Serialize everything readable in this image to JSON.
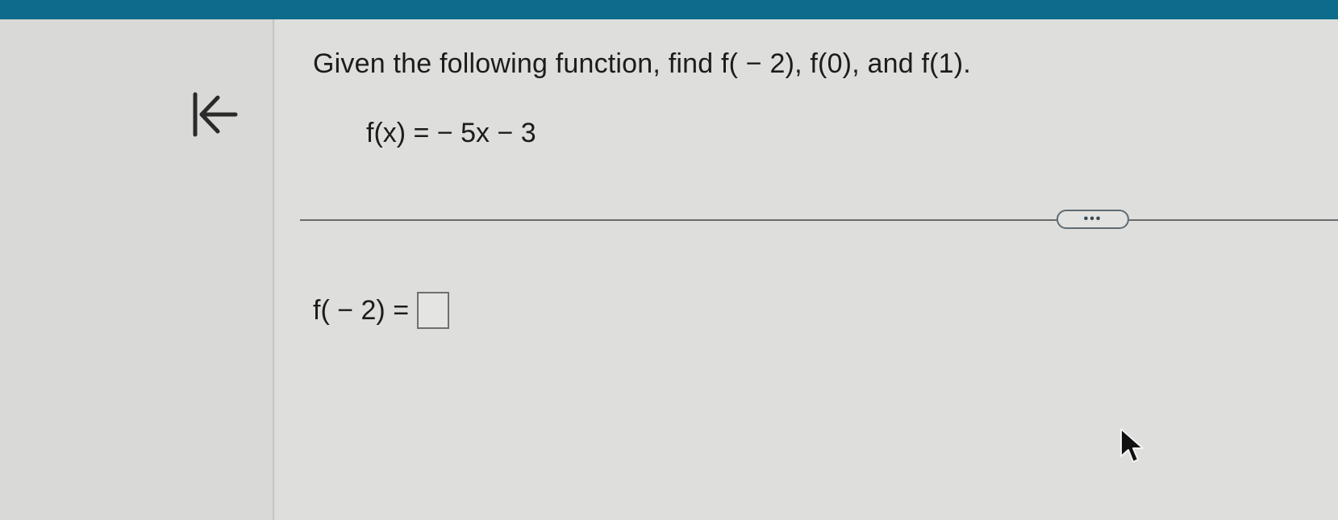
{
  "header": {
    "accent_color": "#0d6b8c"
  },
  "nav": {
    "back_icon": "skip-to-first-icon"
  },
  "question": {
    "prompt": "Given the following function, find f( − 2), f(0), and f(1).",
    "function": "f(x) = − 5x − 3"
  },
  "toolbar": {
    "more_label": "•••"
  },
  "answer": {
    "label": "f( − 2) =",
    "value": ""
  },
  "pointer": {
    "icon": "mouse-pointer-icon"
  }
}
